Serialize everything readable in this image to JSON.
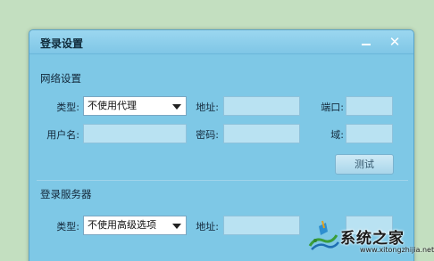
{
  "dialog": {
    "title": "登录设置",
    "minimize_glyph": "",
    "close_glyph": "✕"
  },
  "network": {
    "section_title": "网络设置",
    "type_label": "类型:",
    "type_value": "不使用代理",
    "address_label": "地址:",
    "address_value": "",
    "port_label": "端口:",
    "port_value": "",
    "username_label": "用户名:",
    "username_value": "",
    "password_label": "密码:",
    "password_value": "",
    "domain_label": "域:",
    "domain_value": "",
    "test_button": "测试"
  },
  "server": {
    "section_title": "登录服务器",
    "type_label": "类型:",
    "type_value": "不使用高级选项",
    "address_label": "地址:",
    "address_value": ""
  },
  "watermark": {
    "text": "系统之家",
    "url": "www.xitongzhijia.net"
  },
  "colors": {
    "background": "#c3dfc0",
    "dialog_body": "#7ec8e6",
    "field_fill": "#b9e2f2"
  }
}
